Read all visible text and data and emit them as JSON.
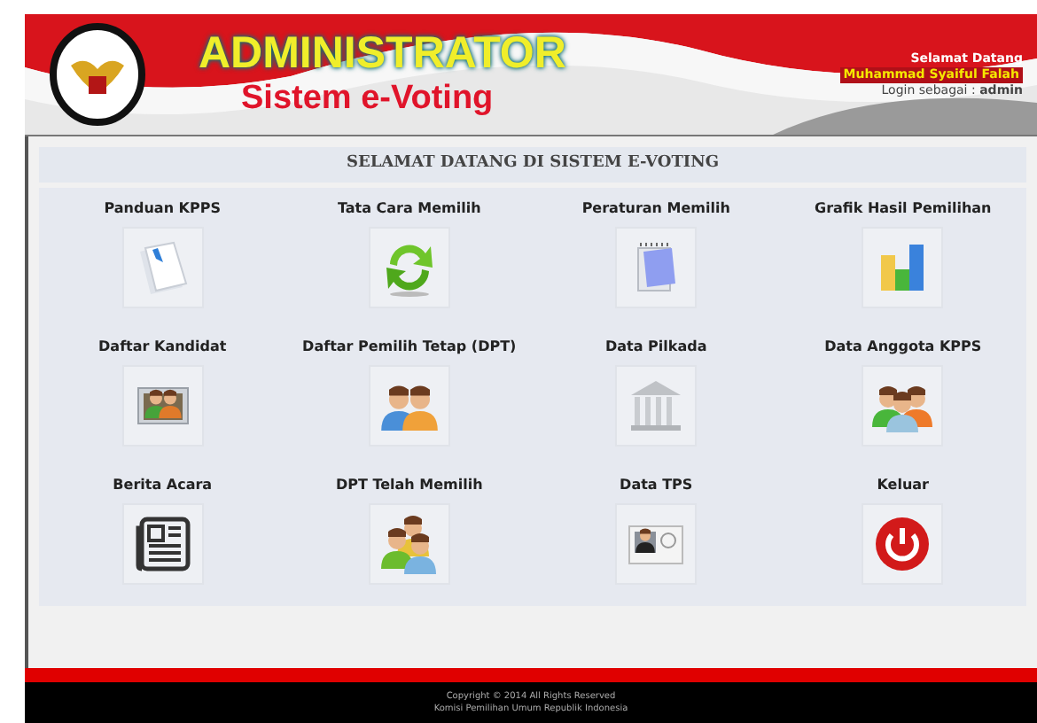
{
  "header": {
    "title": "ADMINISTRATOR",
    "subtitle": "Sistem e-Voting",
    "greeting": "Selamat Datang",
    "user_name": "Muhammad Syaiful Falah",
    "login_info": "Login sebagai : **admin**"
  },
  "page_title": "SELAMAT DATANG DI SISTEM E-VOTING",
  "menu": [
    {
      "label": "Panduan KPPS",
      "kind": "guide"
    },
    {
      "label": "Tata Cara Memilih",
      "kind": "recycle"
    },
    {
      "label": "Peraturan Memilih",
      "kind": "notepad"
    },
    {
      "label": "Grafik Hasil Pemilihan",
      "kind": "chart"
    },
    {
      "label": "Daftar Kandidat",
      "kind": "photo"
    },
    {
      "label": "Daftar Pemilih Tetap (DPT)",
      "kind": "couple"
    },
    {
      "label": "Data Pilkada",
      "kind": "building"
    },
    {
      "label": "Data Anggota KPPS",
      "kind": "group"
    },
    {
      "label": "Berita Acara",
      "kind": "newspaper"
    },
    {
      "label": "DPT Telah Memilih",
      "kind": "team"
    },
    {
      "label": "Data TPS",
      "kind": "contact"
    },
    {
      "label": "Keluar",
      "kind": "power"
    }
  ],
  "footer": {
    "copyright": "Copyright © 2014 All Rights Reserved",
    "organization": "Komisi Pemilihan Umum Republik Indonesia"
  }
}
